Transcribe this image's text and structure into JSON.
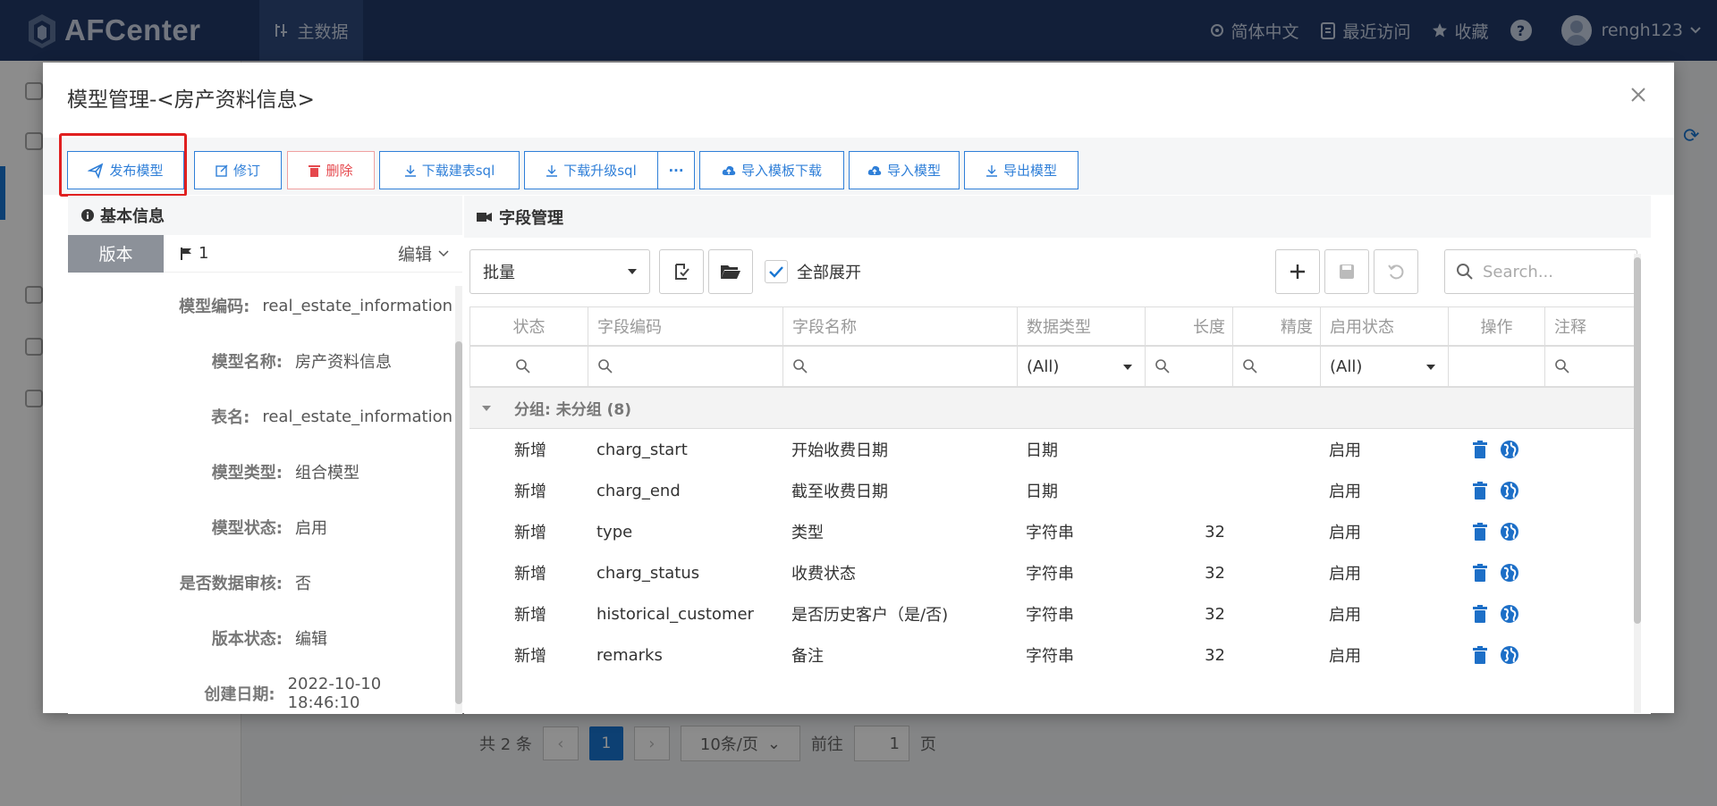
{
  "header": {
    "app_name": "AFCenter",
    "nav_label": "主数据",
    "language": "简体中文",
    "recent": "最近访问",
    "favorites": "收藏",
    "help": "?",
    "username": "rengh123"
  },
  "background": {
    "total": "共 2 条",
    "current_page": "1",
    "page_size": "10条/页",
    "goto_label": "前往",
    "goto_value": "1",
    "page_unit": "页"
  },
  "dialog": {
    "title": "模型管理-<房产资料信息>",
    "toolbar": {
      "publish": "发布模型",
      "revise": "修订",
      "delete": "删除",
      "download_create_sql": "下载建表sql",
      "download_upgrade_sql": "下载升级sql",
      "more": "···",
      "import_template": "导入模板下载",
      "import_model": "导入模型",
      "export_model": "导出模型"
    },
    "basic_info": {
      "header": "基本信息",
      "version_tab": "版本",
      "version_value": "1",
      "edit_label": "编辑",
      "fields": [
        {
          "label": "模型编码:",
          "value": "real_estate_information"
        },
        {
          "label": "模型名称:",
          "value": "房产资料信息"
        },
        {
          "label": "表名:",
          "value": "real_estate_information"
        },
        {
          "label": "模型类型:",
          "value": "组合模型"
        },
        {
          "label": "模型状态:",
          "value": "启用"
        },
        {
          "label": "是否数据审核:",
          "value": "否"
        },
        {
          "label": "版本状态:",
          "value": "编辑"
        },
        {
          "label": "创建日期:",
          "value": "2022-10-10 18:46:10"
        }
      ]
    },
    "field_mgmt": {
      "header": "字段管理",
      "batch_label": "批量",
      "expand_all": "全部展开",
      "expand_checked": true,
      "search_placeholder": "Search...",
      "columns": [
        "状态",
        "字段编码",
        "字段名称",
        "数据类型",
        "长度",
        "精度",
        "启用状态",
        "操作",
        "注释"
      ],
      "filter_all": "(All)",
      "group_label": "分组: 未分组 (8)",
      "rows": [
        {
          "status": "新增",
          "code": "charg_start",
          "name": "开始收费日期",
          "type": "日期",
          "length": "",
          "precision": "",
          "enabled": "启用"
        },
        {
          "status": "新增",
          "code": "charg_end",
          "name": "截至收费日期",
          "type": "日期",
          "length": "",
          "precision": "",
          "enabled": "启用"
        },
        {
          "status": "新增",
          "code": "type",
          "name": "类型",
          "type": "字符串",
          "length": "32",
          "precision": "",
          "enabled": "启用"
        },
        {
          "status": "新增",
          "code": "charg_status",
          "name": "收费状态",
          "type": "字符串",
          "length": "32",
          "precision": "",
          "enabled": "启用"
        },
        {
          "status": "新增",
          "code": "historical_customer",
          "name": "是否历史客户（是/否)",
          "type": "字符串",
          "length": "32",
          "precision": "",
          "enabled": "启用"
        },
        {
          "status": "新增",
          "code": "remarks",
          "name": "备注",
          "type": "字符串",
          "length": "32",
          "precision": "",
          "enabled": "启用"
        }
      ]
    }
  }
}
